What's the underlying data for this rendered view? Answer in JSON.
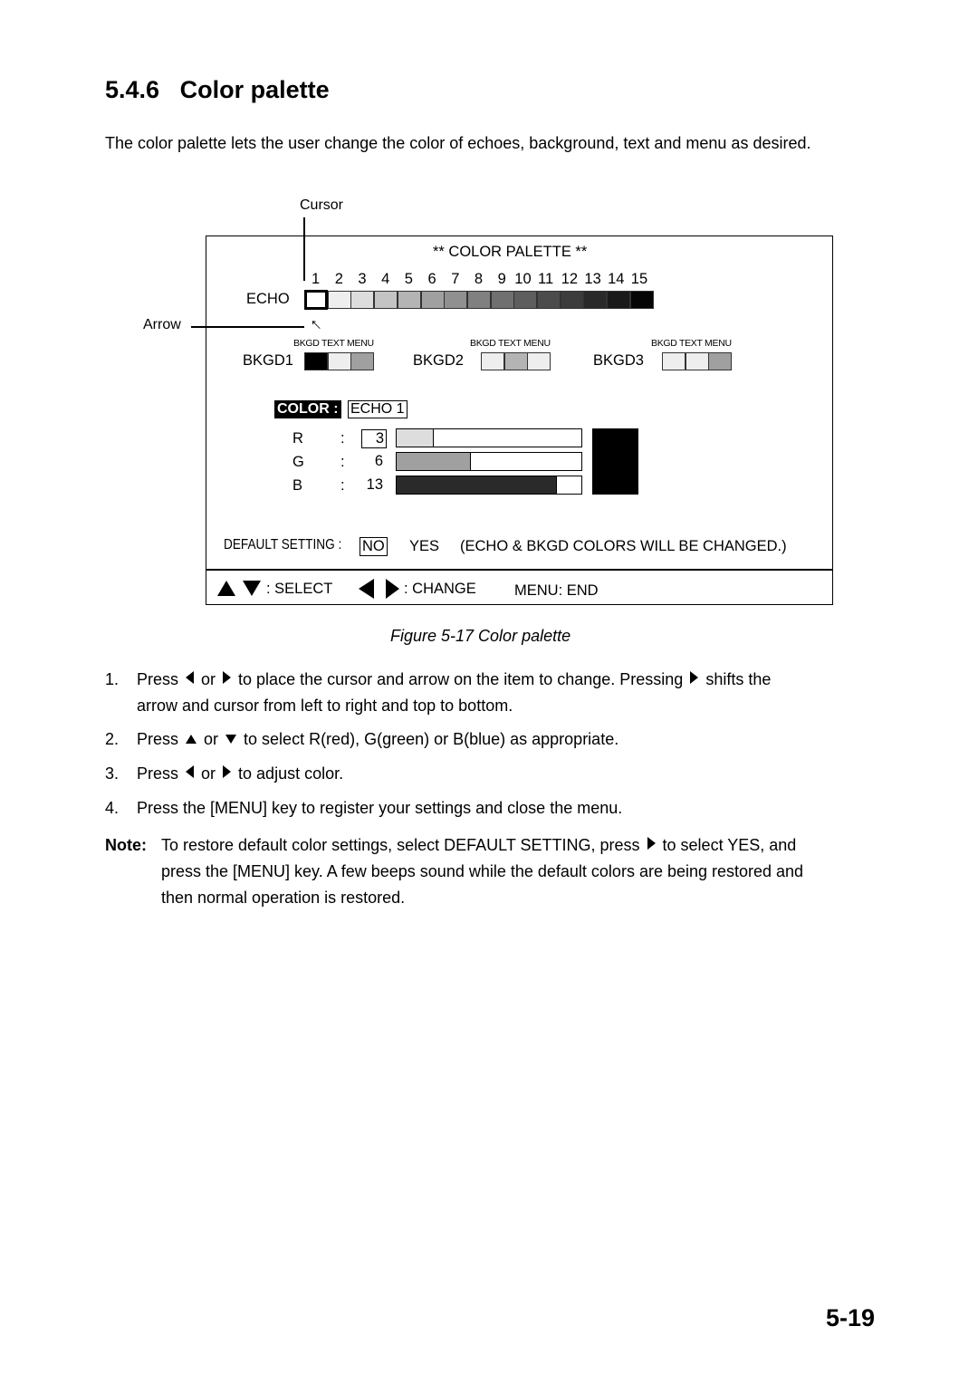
{
  "section": {
    "number": "5.4.6",
    "title": "Color palette"
  },
  "intro": "The color palette lets the user change the color of echoes, background, text and menu as desired.",
  "figure": {
    "callouts": {
      "cursor": "Cursor",
      "arrow": "Arrow"
    },
    "title": "** COLOR PALETTE **",
    "echo_label": "ECHO",
    "echo_numbers": [
      "1",
      "2",
      "3",
      "4",
      "5",
      "6",
      "7",
      "8",
      "9",
      "10",
      "11",
      "12",
      "13",
      "14",
      "15"
    ],
    "echo_colors": [
      "#ffffff",
      "#eeeeee",
      "#dddddd",
      "#c4c4c4",
      "#b4b4b4",
      "#a0a0a0",
      "#909090",
      "#808080",
      "#707070",
      "#5e5e5e",
      "#4c4c4c",
      "#3c3c3c",
      "#2a2a2a",
      "#1a1a1a",
      "#050505"
    ],
    "bkgd_header": "BKGD TEXT MENU",
    "bkgds": [
      {
        "label": "BKGD1",
        "colors": [
          "#000000",
          "#eeeeee",
          "#a0a0a0"
        ]
      },
      {
        "label": "BKGD2",
        "colors": [
          "#eeeeee",
          "#b4b4b4",
          "#eeeeee"
        ]
      },
      {
        "label": "BKGD3",
        "colors": [
          "#eeeeee",
          "#eeeeee",
          "#a0a0a0"
        ]
      }
    ],
    "color_label": "COLOR :",
    "color_value": "ECHO 1",
    "rgb": [
      {
        "label": "R",
        "value": "3",
        "level": 3,
        "fill": "#dddddd"
      },
      {
        "label": "G",
        "value": "6",
        "level": 6,
        "fill": "#a0a0a0"
      },
      {
        "label": "B",
        "value": "13",
        "level": 13,
        "fill": "#2a2a2a"
      }
    ],
    "rgb_max": 15,
    "preview_color": "#000000",
    "default_setting": {
      "label": "DEFAULT SETTING :",
      "no": "NO",
      "yes": "YES",
      "note": "(ECHO & BKGD COLORS WILL BE CHANGED.)"
    },
    "footer": {
      "select": ": SELECT",
      "change": ": CHANGE",
      "menu": "MENU: END"
    },
    "caption": "Figure 5-17 Color palette"
  },
  "steps": [
    {
      "num": "1.",
      "parts": [
        "Press",
        "or",
        "to place the cursor and arrow on the item to change. Pressing",
        "shifts the"
      ],
      "line2": "arrow and cursor from left to right and top to bottom."
    },
    {
      "num": "2.",
      "parts": [
        "Press",
        "or",
        "to select R(red), G(green) or B(blue) as appropriate."
      ]
    },
    {
      "num": "3.",
      "parts": [
        "Press",
        "or",
        "to adjust color."
      ]
    },
    {
      "num": "4.",
      "text": "Press the [MENU] key to register your settings and close the menu."
    }
  ],
  "note": {
    "label": "Note:",
    "parts": [
      "To restore default color settings, select DEFAULT SETTING, press",
      "to select YES, and"
    ],
    "line2": "press the [MENU] key. A few beeps sound while the default colors are being restored and",
    "line3": "then normal operation is restored."
  },
  "page_number": "5-19"
}
